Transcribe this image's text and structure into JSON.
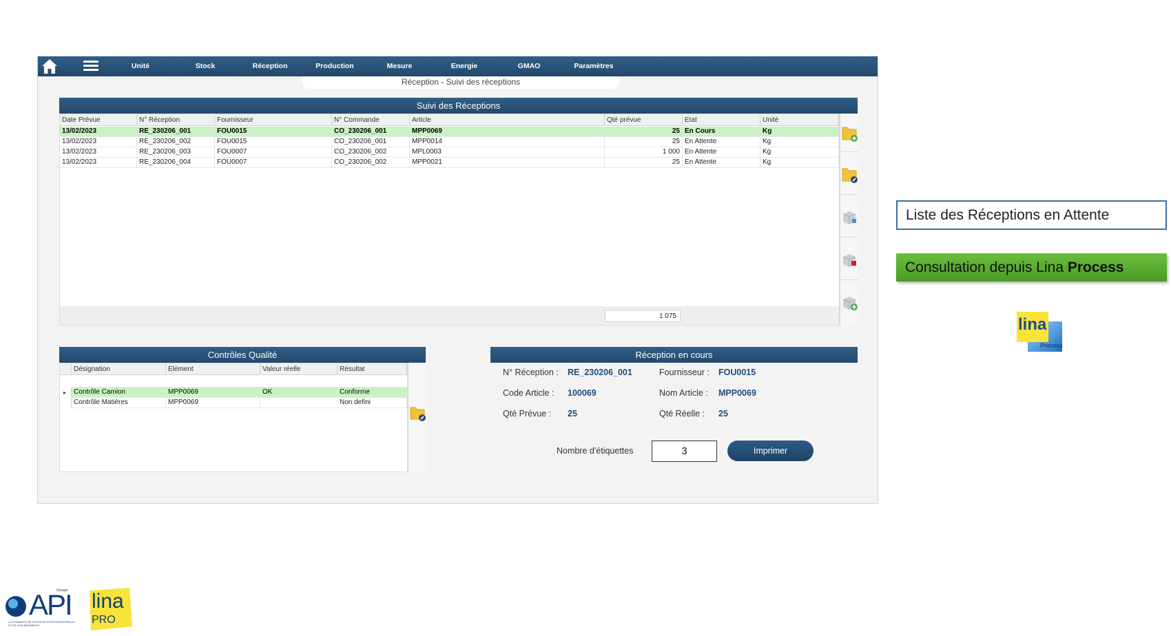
{
  "nav": {
    "items": [
      "Unité",
      "Stock",
      "Réception",
      "Production",
      "Mesure",
      "Energie",
      "GMAO",
      "Paramètres"
    ]
  },
  "subtitle": "Réception - Suivi des réceptions",
  "suivi": {
    "title": "Suivi des Réceptions",
    "columns": [
      "Date Prévue",
      "N° Réception",
      "Fournisseur",
      "N° Commande",
      "Article",
      "Qté prévue",
      "Etat",
      "Unité"
    ],
    "rows": [
      [
        "13/02/2023",
        "RE_230206_001",
        "FOU0015",
        "CO_230206_001",
        "MPP0069",
        "25",
        "En Cours",
        "Kg"
      ],
      [
        "13/02/2023",
        "RE_230206_002",
        "FOU0015",
        "CO_230206_001",
        "MPP0014",
        "25",
        "En Attente",
        "Kg"
      ],
      [
        "13/02/2023",
        "RE_230206_003",
        "FOU0007",
        "CO_230206_002",
        "MPL0003",
        "1 000",
        "En Attente",
        "Kg"
      ],
      [
        "13/02/2023",
        "RE_230206_004",
        "FOU0007",
        "CO_230206_002",
        "MPP0021",
        "25",
        "En Attente",
        "Kg"
      ]
    ],
    "total": "1 075"
  },
  "controles": {
    "title": "Contrôles Qualité",
    "columns": [
      "Désignation",
      "Elément",
      "Valeur réelle",
      "Résultat"
    ],
    "rows": [
      [
        "Contrôle Camion",
        "MPP0069",
        "OK",
        "Conforme"
      ],
      [
        "Contrôle Matières",
        "MPP0069",
        "",
        "Non defini"
      ]
    ]
  },
  "reception_en_cours": {
    "title": "Réception en cours",
    "no_reception_label": "N° Réception :",
    "no_reception": "RE_230206_001",
    "fournisseur_label": "Fournisseur :",
    "fournisseur": "FOU0015",
    "code_article_label": "Code Article :",
    "code_article": "100069",
    "nom_article_label": "Nom Article :",
    "nom_article": "MPP0069",
    "qte_prevue_label": "Qté Prévue :",
    "qte_prevue": "25",
    "qte_reelle_label": "Qté Réelle :",
    "qte_reelle": "25",
    "etiquettes_label": "Nombre d'étiquettes",
    "etiquettes": "3",
    "print_label": "Imprimer"
  },
  "callouts": {
    "liste": "Liste des Réceptions en Attente",
    "consult_prefix": "Consultation depuis Lina ",
    "consult_bold": "Process"
  },
  "logos": {
    "lina_process": "lina",
    "lina_process_sub": "Process",
    "api": "API",
    "api_groupe": "Groupe",
    "api_tagline": "LA CONDUITE DE VOTRE ACTIVITÉ INDUSTRIELLE ET DE VOS BÂTIMENTS",
    "lina_pro": "lina",
    "lina_pro_sub": "PRO"
  },
  "colors": {
    "nav_blue": "#24496c",
    "selected_row": "#c9f2c2",
    "callout_green": "#5aab30",
    "value_blue": "#1f4b7a"
  }
}
